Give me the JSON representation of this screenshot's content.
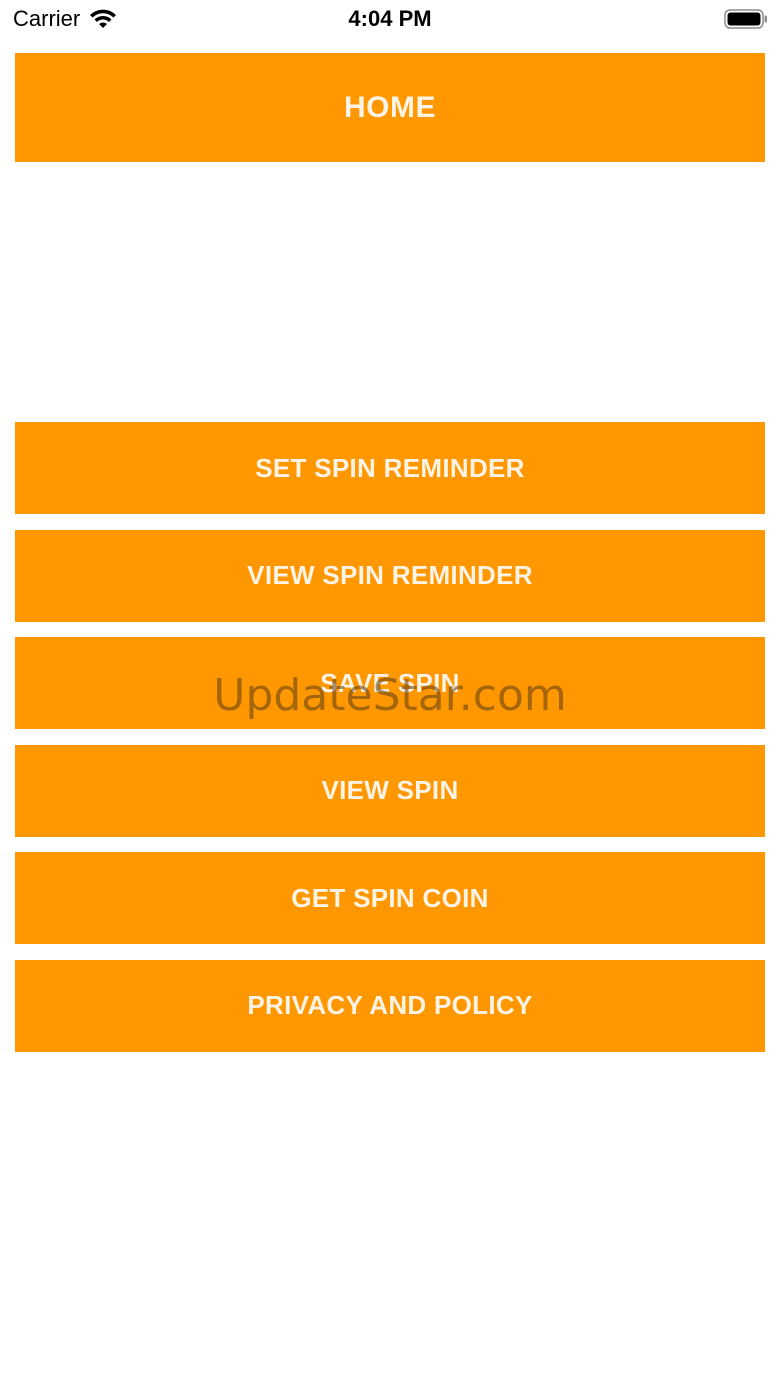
{
  "status_bar": {
    "carrier": "Carrier",
    "time": "4:04 PM"
  },
  "header": {
    "title": "HOME"
  },
  "menu": {
    "items": [
      {
        "label": "SET SPIN REMINDER"
      },
      {
        "label": "VIEW SPIN REMINDER"
      },
      {
        "label": "SAVE SPIN"
      },
      {
        "label": "VIEW SPIN"
      },
      {
        "label": "GET SPIN COIN"
      },
      {
        "label": "PRIVACY AND POLICY"
      }
    ]
  },
  "watermark": {
    "text": "UpdateStar.com"
  },
  "colors": {
    "accent": "#FF9800",
    "button_text": "#FFF3E6",
    "background": "#FFFFFF"
  },
  "icons": [
    "wifi-icon",
    "battery-icon"
  ]
}
